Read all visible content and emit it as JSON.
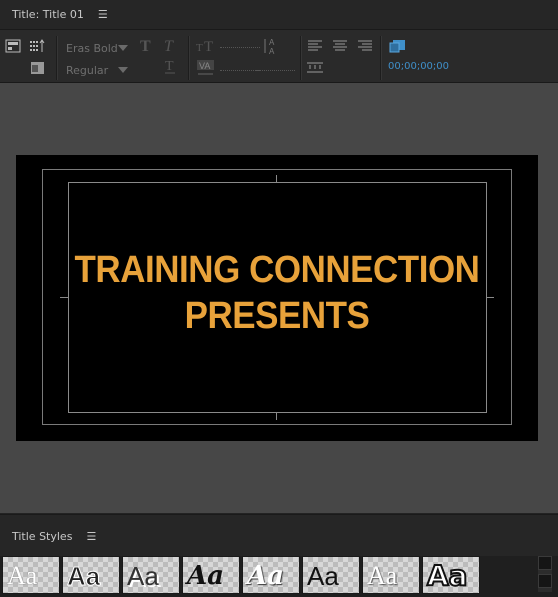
{
  "header": {
    "title": "Title: Title 01",
    "menu_icon": "panel-menu-icon"
  },
  "toolbar": {
    "font_family": "Eras Bold",
    "font_style": "Regular",
    "timecode": "00;00;00;00",
    "icons": [
      "title-type-icon",
      "roll-crawl-icon",
      "template-icon",
      "bold-icon",
      "italic-icon",
      "underline-icon",
      "font-size-icon",
      "kerning-icon",
      "leading-icon",
      "align-left-icon",
      "align-center-icon",
      "align-right-icon",
      "tab-stops-icon",
      "show-video-icon"
    ]
  },
  "canvas": {
    "title_lines": [
      "TRAINING CONNECTION",
      "PRESENTS"
    ],
    "text_color": "#e8a23a",
    "background": "#000000"
  },
  "styles_panel": {
    "title": "Title Styles",
    "swatches": [
      {
        "label": "Aa",
        "style": "serif-light"
      },
      {
        "label": "Aa",
        "style": "sans-bold-outline"
      },
      {
        "label": "Aa",
        "style": "sans-shadow"
      },
      {
        "label": "Aa",
        "style": "script-dark"
      },
      {
        "label": "Aa",
        "style": "script-white"
      },
      {
        "label": "Aa",
        "style": "sans-dark"
      },
      {
        "label": "Aa",
        "style": "serif-white"
      },
      {
        "label": "Aa",
        "style": "block-white"
      }
    ]
  }
}
